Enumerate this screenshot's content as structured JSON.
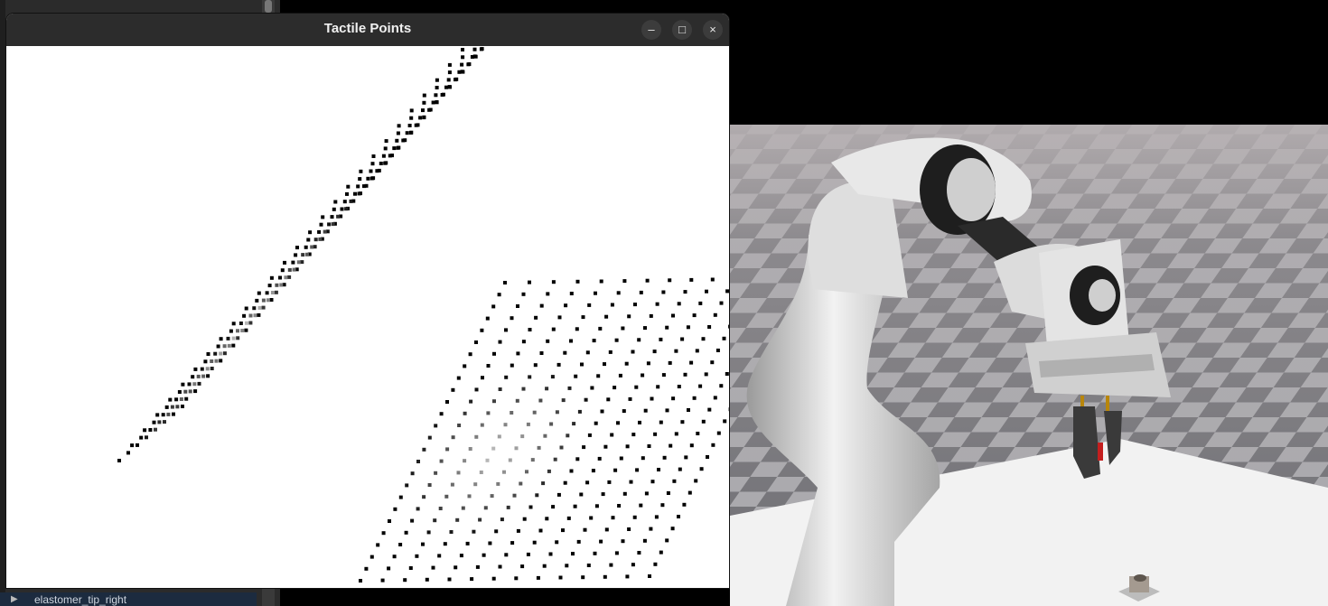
{
  "window": {
    "title": "Tactile Points",
    "minimize_icon": "–",
    "maximize_icon": "□",
    "close_icon": "×"
  },
  "side_panel": {
    "tree_item_label": "elastomer_tip_right",
    "expander_icon": "▶"
  },
  "viewport": {
    "sky_color": "#000000",
    "floor_light": "#a9a9ad",
    "floor_dark": "#6e6e73",
    "table_color": "#f2f2f2",
    "robot_color": "#d9d9d9",
    "gripper_accent": "#b8860b"
  }
}
